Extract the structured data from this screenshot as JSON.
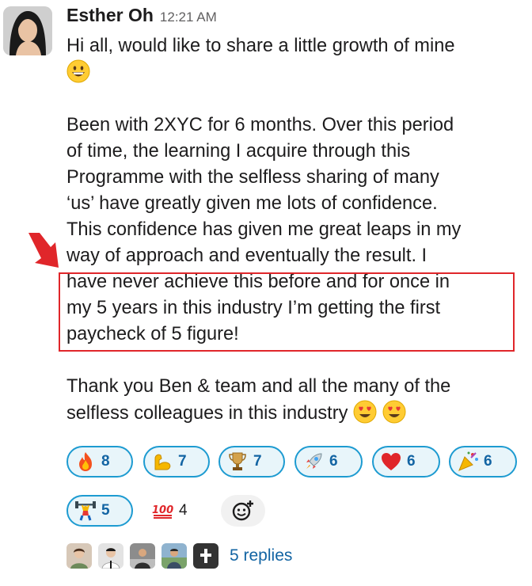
{
  "message": {
    "author": "Esther Oh",
    "time": "12:21 AM",
    "paragraphs": [
      "Hi all, would like to share a little growth of mine",
      "Been with 2XYC for 6 months. Over this period of time, the learning I acquire through this Programme with the selfless sharing of many ‘us’ have greatly given me lots of confidence. This confidence has given me great leaps in my way of approach and eventually the result. I have never achieve this before and for once in my 5 years in this industry I’m getting the first paycheck of 5 figure!",
      "Thank you Ben & team and all the many of the selfless colleagues in this industry"
    ],
    "line_texts": [
      "Been with 2XYC for 6 months. Over this period",
      "of time, the learning I acquire through this",
      "Programme with the selfless sharing of many",
      "‘us’ have greatly given me lots of confidence.",
      "This confidence has given me great leaps in my",
      "way of approach and eventually the result. I",
      "have never achieve this before and for once in",
      "my 5 years in this industry I’m getting the first",
      "paycheck of 5 figure!"
    ],
    "thanks_lines": [
      "Thank you Ben & team and all the many of the",
      "selfless colleagues in this industry"
    ]
  },
  "reactions": [
    {
      "icon": "fire-icon",
      "count": "8"
    },
    {
      "icon": "flexed-biceps-icon",
      "count": "7"
    },
    {
      "icon": "trophy-icon",
      "count": "7"
    },
    {
      "icon": "rocket-icon",
      "count": "6"
    },
    {
      "icon": "red-heart-icon",
      "count": "6"
    },
    {
      "icon": "party-popper-icon",
      "count": "6"
    },
    {
      "icon": "weightlifter-icon",
      "count": "5"
    },
    {
      "icon": "hundred-points-icon",
      "count": "4"
    }
  ],
  "thread": {
    "replies_label": "5 replies"
  },
  "colors": {
    "highlight": "#e0262a",
    "reaction_border": "#1d9bd1",
    "link": "#1264a3"
  }
}
